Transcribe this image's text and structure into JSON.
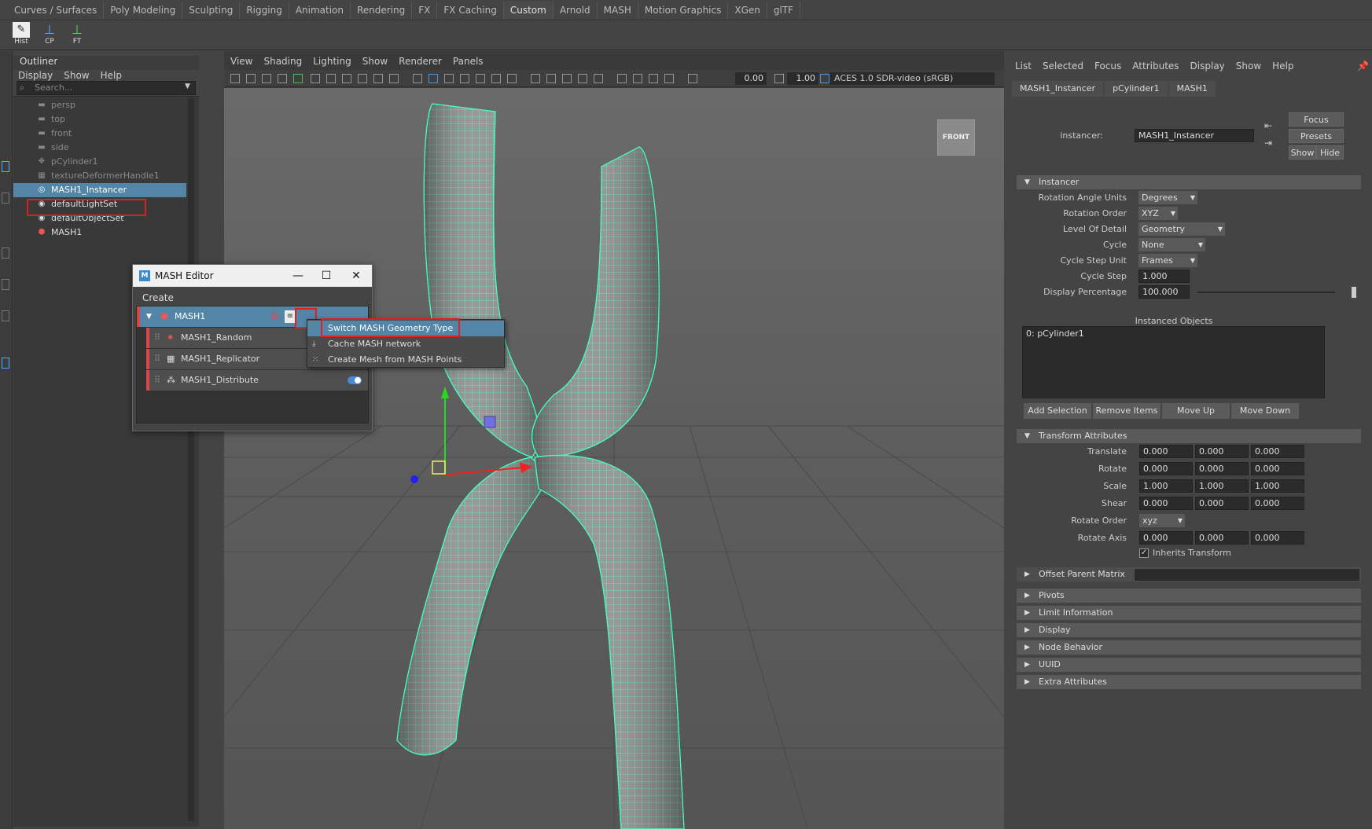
{
  "shelf_tabs": [
    "Curves / Surfaces",
    "Poly Modeling",
    "Sculpting",
    "Rigging",
    "Animation",
    "Rendering",
    "FX",
    "FX Caching",
    "Custom",
    "Arnold",
    "MASH",
    "Motion Graphics",
    "XGen",
    "glTF"
  ],
  "active_shelf_tab": "Custom",
  "shelf_icons": [
    {
      "label": "Hist",
      "icon": "history-icon"
    },
    {
      "label": "CP",
      "icon": "center-pivot-icon"
    },
    {
      "label": "FT",
      "icon": "freeze-transform-icon"
    }
  ],
  "outliner": {
    "title": "Outliner",
    "menu": [
      "Display",
      "Show",
      "Help"
    ],
    "search_placeholder": "Search...",
    "items": [
      {
        "label": "persp",
        "icon": "camera-icon",
        "dim": true
      },
      {
        "label": "top",
        "icon": "camera-icon",
        "dim": true
      },
      {
        "label": "front",
        "icon": "camera-icon",
        "dim": true
      },
      {
        "label": "side",
        "icon": "camera-icon",
        "dim": true
      },
      {
        "label": "pCylinder1",
        "icon": "transform-icon",
        "dim": true
      },
      {
        "label": "textureDeformerHandle1",
        "icon": "deformer-icon",
        "dim": true
      },
      {
        "label": "MASH1_Instancer",
        "icon": "instancer-icon",
        "selected": true
      },
      {
        "label": "defaultLightSet",
        "icon": "set-icon"
      },
      {
        "label": "defaultObjectSet",
        "icon": "set-icon"
      },
      {
        "label": "MASH1",
        "icon": "mash-icon"
      }
    ]
  },
  "viewport": {
    "menu": [
      "View",
      "Shading",
      "Lighting",
      "Show",
      "Renderer",
      "Panels"
    ],
    "field_a": "0.00",
    "field_b": "1.00",
    "color_space": "ACES 1.0 SDR-video (sRGB)",
    "view_cube": "FRONT"
  },
  "mash_editor": {
    "title": "MASH Editor",
    "menu": "Create",
    "network": "MASH1",
    "nodes": [
      "MASH1_Random",
      "MASH1_Replicator",
      "MASH1_Distribute"
    ]
  },
  "context_menu": {
    "items": [
      "Switch MASH Geometry Type",
      "Cache MASH network",
      "Create Mesh from MASH Points"
    ]
  },
  "attribute_editor": {
    "menu": [
      "List",
      "Selected",
      "Focus",
      "Attributes",
      "Display",
      "Show",
      "Help"
    ],
    "tabs": [
      "MASH1_Instancer",
      "pCylinder1",
      "MASH1"
    ],
    "instancer_label": "instancer:",
    "instancer_value": "MASH1_Instancer",
    "buttons": {
      "focus": "Focus",
      "presets": "Presets",
      "show": "Show",
      "hide": "Hide"
    },
    "instancer_section": {
      "title": "Instancer",
      "rotation_angle_units_label": "Rotation Angle Units",
      "rotation_angle_units": "Degrees",
      "rotation_order_label": "Rotation Order",
      "rotation_order": "XYZ",
      "lod_label": "Level Of Detail",
      "lod": "Geometry",
      "cycle_label": "Cycle",
      "cycle": "None",
      "cycle_step_unit_label": "Cycle Step Unit",
      "cycle_step_unit": "Frames",
      "cycle_step_label": "Cycle Step",
      "cycle_step": "1.000",
      "display_pct_label": "Display Percentage",
      "display_pct": "100.000",
      "instanced_objects_label": "Instanced Objects",
      "instanced_objects": "0: pCylinder1",
      "buttons": [
        "Add Selection",
        "Remove Items",
        "Move Up",
        "Move Down"
      ]
    },
    "transform_section": {
      "title": "Transform Attributes",
      "translate_label": "Translate",
      "translate": [
        "0.000",
        "0.000",
        "0.000"
      ],
      "rotate_label": "Rotate",
      "rotate": [
        "0.000",
        "0.000",
        "0.000"
      ],
      "scale_label": "Scale",
      "scale": [
        "1.000",
        "1.000",
        "1.000"
      ],
      "shear_label": "Shear",
      "shear": [
        "0.000",
        "0.000",
        "0.000"
      ],
      "rotate_order_label": "Rotate Order",
      "rotate_order": "xyz",
      "rotate_axis_label": "Rotate Axis",
      "rotate_axis": [
        "0.000",
        "0.000",
        "0.000"
      ],
      "inherits_transform": "Inherits Transform",
      "offset_parent_matrix": "Offset Parent Matrix"
    },
    "collapsed_sections": [
      "Pivots",
      "Limit Information",
      "Display",
      "Node Behavior",
      "UUID",
      "Extra Attributes"
    ]
  },
  "colors": {
    "highlight": "#5285a6",
    "mesh_wire": "#44ffbb",
    "annotation_red": "#e02020"
  }
}
